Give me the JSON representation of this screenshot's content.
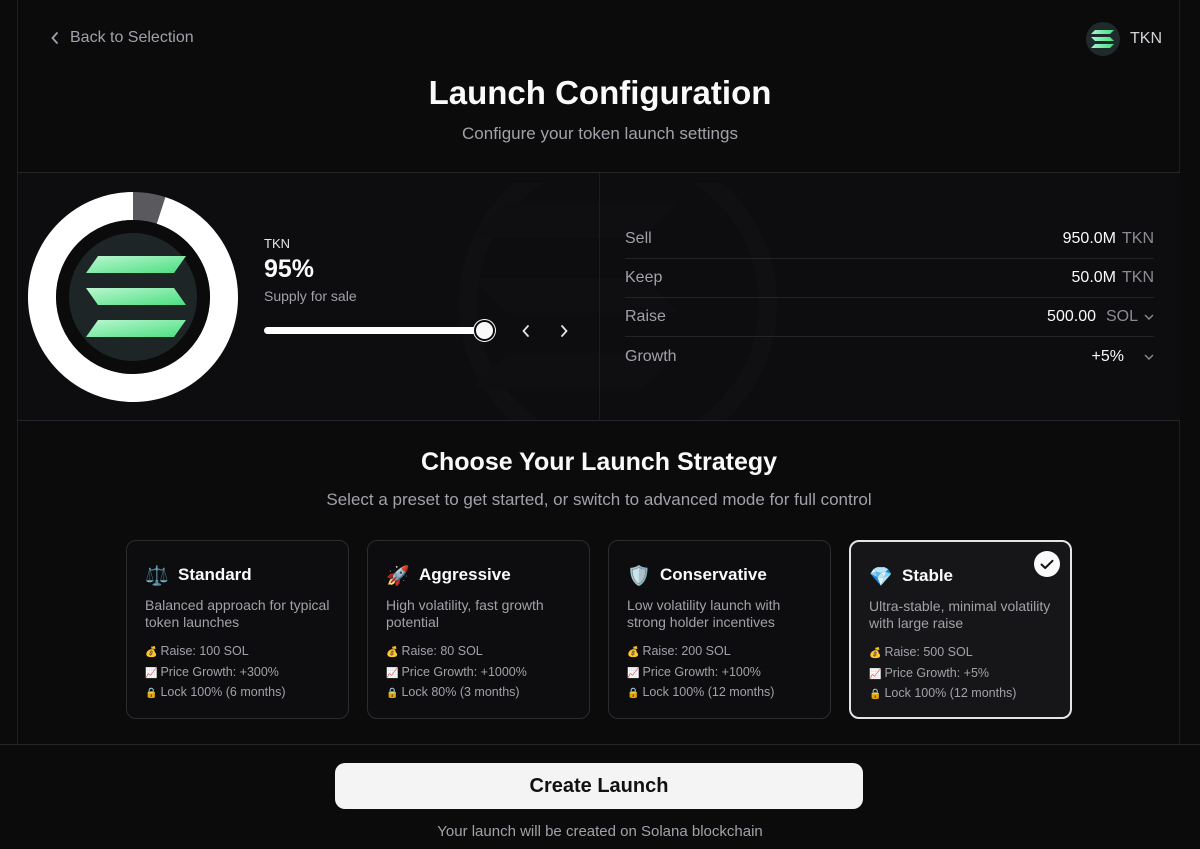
{
  "header": {
    "back_label": "Back to Selection",
    "token_symbol": "TKN",
    "title": "Launch Configuration",
    "subtitle": "Configure your token launch settings"
  },
  "supply": {
    "token": "TKN",
    "percent_label": "95%",
    "percent_value": 0.95,
    "caption": "Supply for sale"
  },
  "stats": [
    {
      "key": "Sell",
      "value": "950.0M",
      "unit": "TKN",
      "dropdown": false
    },
    {
      "key": "Keep",
      "value": "50.0M",
      "unit": "TKN",
      "dropdown": false
    },
    {
      "key": "Raise",
      "value": "500.00",
      "unit": "SOL",
      "dropdown": true
    },
    {
      "key": "Growth",
      "value": "+5%",
      "unit": "",
      "dropdown": true
    }
  ],
  "strategy": {
    "title": "Choose Your Launch Strategy",
    "subtitle": "Select a preset to get started, or switch to advanced mode for full control",
    "cards": [
      {
        "emoji": "⚖️",
        "icon": "scales-icon",
        "name": "Standard",
        "desc": "Balanced approach for typical token launches",
        "raise": "Raise: 100 SOL",
        "growth": "Price Growth: +300%",
        "lock": "Lock 100% (6 months)",
        "selected": false
      },
      {
        "emoji": "🚀",
        "icon": "rocket-icon",
        "name": "Aggressive",
        "desc": "High volatility, fast growth potential",
        "raise": "Raise: 80 SOL",
        "growth": "Price Growth: +1000%",
        "lock": "Lock 80% (3 months)",
        "selected": false
      },
      {
        "emoji": "🛡️",
        "icon": "shield-icon",
        "name": "Conservative",
        "desc": "Low volatility launch with strong holder incentives",
        "raise": "Raise: 200 SOL",
        "growth": "Price Growth: +100%",
        "lock": "Lock 100% (12 months)",
        "selected": false
      },
      {
        "emoji": "💎",
        "icon": "diamond-icon",
        "name": "Stable",
        "desc": "Ultra-stable, minimal volatility with large raise",
        "raise": "Raise: 500 SOL",
        "growth": "Price Growth: +5%",
        "lock": "Lock 100% (12 months)",
        "selected": true
      }
    ],
    "meta_icons": {
      "raise": "💰",
      "growth": "📈",
      "lock": "🔒"
    }
  },
  "footer": {
    "cta_label": "Create Launch",
    "note": "Your launch will be created on Solana blockchain"
  },
  "colors": {
    "background": "#0b0b0c",
    "accent_green": "#6ee7a0",
    "selected_border": "#e4e4e7"
  }
}
